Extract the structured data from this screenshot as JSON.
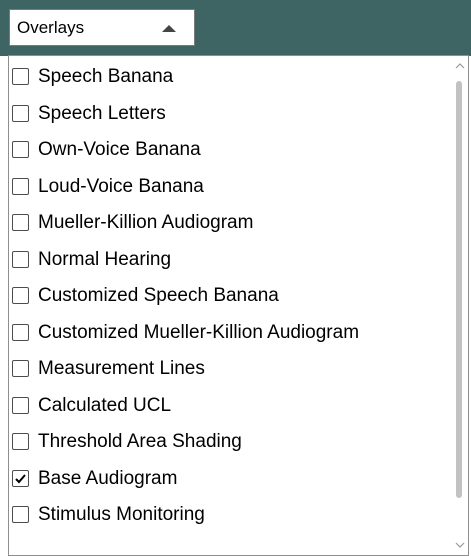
{
  "combo": {
    "label": "Overlays",
    "arrow_icon": "triangle-up-icon"
  },
  "dropdown": {
    "items": [
      {
        "label": "Speech Banana",
        "checked": false
      },
      {
        "label": "Speech Letters",
        "checked": false
      },
      {
        "label": "Own-Voice Banana",
        "checked": false
      },
      {
        "label": "Loud-Voice Banana",
        "checked": false
      },
      {
        "label": "Mueller-Killion Audiogram",
        "checked": false
      },
      {
        "label": "Normal Hearing",
        "checked": false
      },
      {
        "label": "Customized Speech Banana",
        "checked": false
      },
      {
        "label": "Customized Mueller-Killion Audiogram",
        "checked": false
      },
      {
        "label": "Measurement Lines",
        "checked": false
      },
      {
        "label": "Calculated UCL",
        "checked": false
      },
      {
        "label": "Threshold Area Shading",
        "checked": false
      },
      {
        "label": "Base Audiogram",
        "checked": true
      },
      {
        "label": "Stimulus Monitoring",
        "checked": false
      }
    ]
  },
  "colors": {
    "header_background": "#3e6563",
    "scroll_thumb": "#c2c2c2"
  }
}
